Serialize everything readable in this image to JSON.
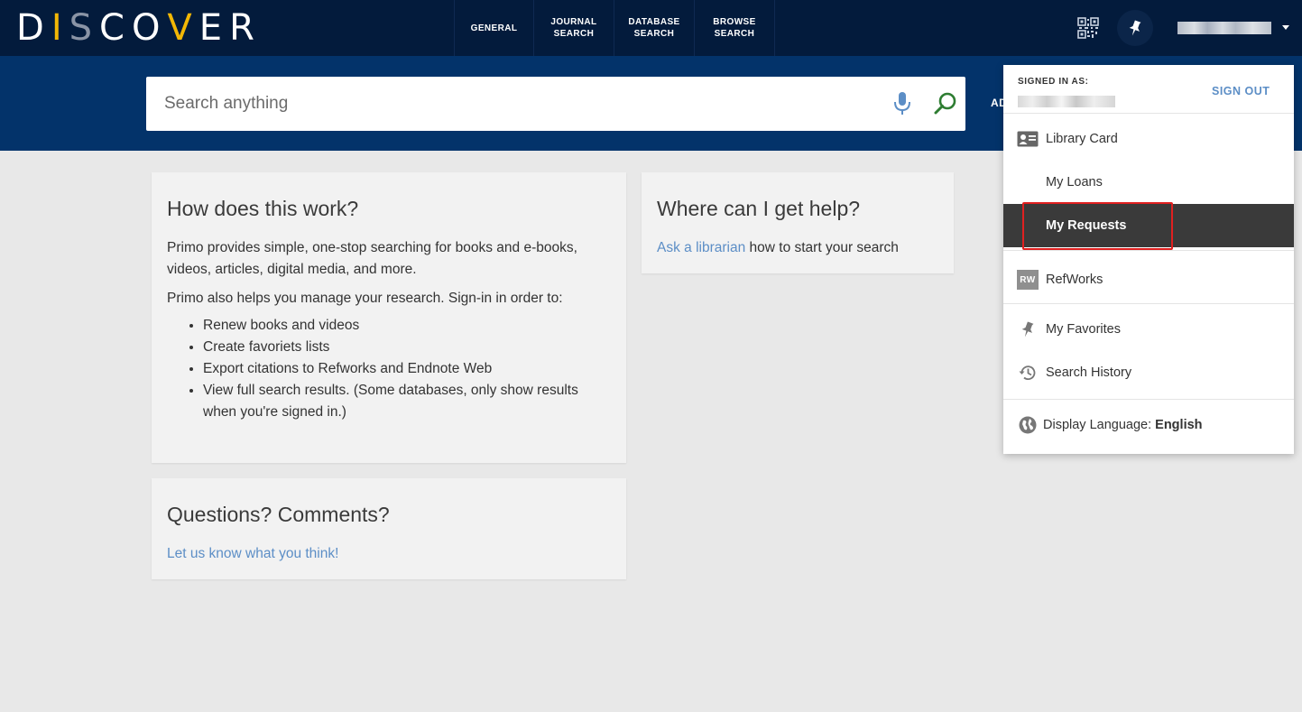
{
  "header": {
    "logo_text": "DISCOVER",
    "nav_tabs": [
      {
        "line1": "GENERAL",
        "line2": ""
      },
      {
        "line1": "JOURNAL",
        "line2": "SEARCH"
      },
      {
        "line1": "DATABASE",
        "line2": "SEARCH"
      },
      {
        "line1": "BROWSE",
        "line2": "SEARCH"
      }
    ],
    "icons": [
      "qr-code-icon",
      "pin-icon",
      "chevron-down-icon"
    ]
  },
  "search": {
    "placeholder": "Search anything",
    "advanced_label": "AD",
    "icons": [
      "microphone-icon",
      "search-icon"
    ]
  },
  "cards": {
    "how": {
      "title": "How does this work?",
      "para1": "Primo provides simple, one-stop searching for books and e-books, videos, articles, digital media, and more.",
      "para2": "Primo also helps you manage your research. Sign-in in order to:",
      "items": [
        "Renew books and videos",
        "Create favoriets lists",
        "Export citations to Refworks and Endnote Web",
        "View full search results. (Some databases, only show results when you're signed in.)"
      ]
    },
    "help": {
      "title": "Where can I get help?",
      "link": "Ask a librarian",
      "rest": " how to start your search"
    },
    "questions": {
      "title": "Questions? Comments?",
      "link": "Let us know what you think!"
    }
  },
  "user_menu": {
    "signed_in_label": "SIGNED IN AS:",
    "sign_out": "SIGN OUT",
    "items": [
      {
        "label": "Library Card",
        "icon": "id-card-icon"
      },
      {
        "label": "My Loans",
        "icon": ""
      },
      {
        "label": "My Requests",
        "icon": "",
        "active": true
      },
      {
        "label": "RefWorks",
        "icon": "refworks-icon",
        "badge": "RW"
      },
      {
        "label": "My Favorites",
        "icon": "pin-icon"
      },
      {
        "label": "Search History",
        "icon": "history-icon"
      }
    ],
    "language_label": "Display Language:",
    "language_value": "English"
  },
  "colors": {
    "topbar": "#031b3c",
    "search_band": "#03336a",
    "logo_accent": "#f2b705",
    "link": "#5c8ec6",
    "active_item": "#3a3a3a",
    "highlight": "#e02020",
    "search_icon": "#2e7d32",
    "mic_icon": "#5c8ec6"
  }
}
